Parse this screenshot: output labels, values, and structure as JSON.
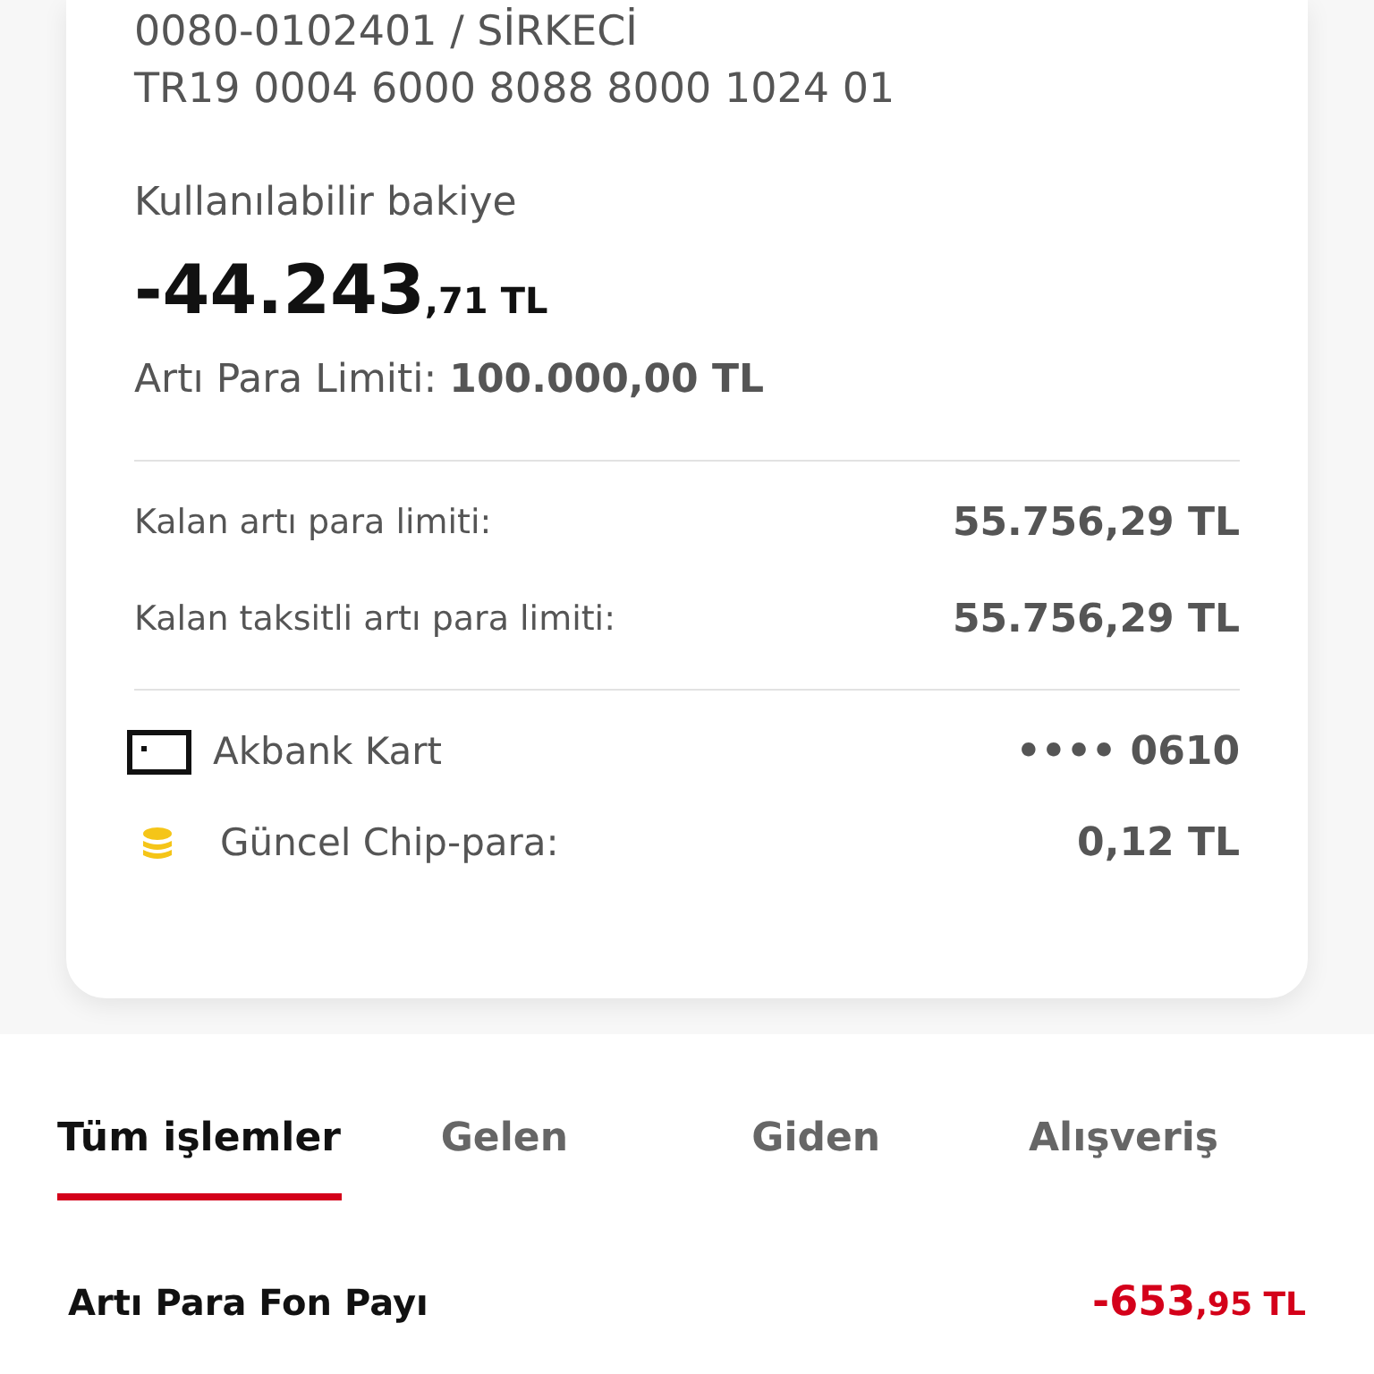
{
  "account": {
    "branch": "0080-0102401 / SİRKECİ",
    "iban": "TR19 0004 6000 8088 8000 1024 01"
  },
  "balance": {
    "label": "Kullanılabilir bakiye",
    "integer": "-44.243",
    "fraction": ",71 TL",
    "limit": "Artı Para Limiti: **100.000,00 TL**"
  },
  "limits": [
    {
      "label": "Kalan artı para limiti:",
      "value": "55.756,29 TL"
    },
    {
      "label": "Kalan taksitli artı para limiti:",
      "value": "55.756,29 TL"
    }
  ],
  "extras": [
    {
      "kind": "card",
      "label": "Akbank Kart",
      "value": "•••• 0610"
    },
    {
      "kind": "chip",
      "label": "Güncel Chip-para:",
      "value": "0,12 TL"
    }
  ],
  "tabs": [
    {
      "label": "Tüm işlemler",
      "selected": true
    },
    {
      "label": "Gelen",
      "selected": false
    },
    {
      "label": "Giden",
      "selected": false
    },
    {
      "label": "Alışveriş",
      "selected": false
    }
  ],
  "transactions": [
    {
      "title": "Artı Para Fon Payı",
      "integer": "-653",
      "fraction": ",95 TL"
    }
  ]
}
